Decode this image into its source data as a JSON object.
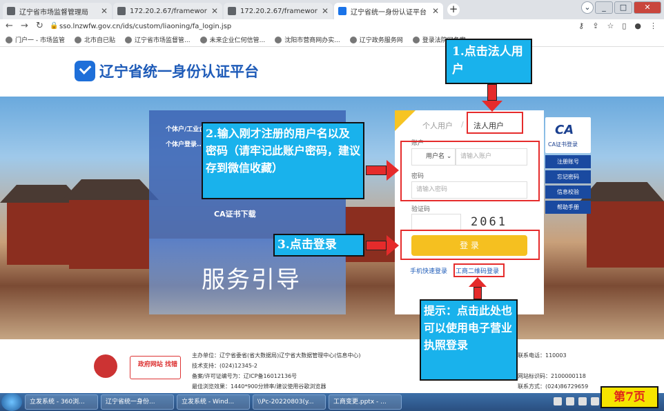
{
  "browser": {
    "tabs": [
      {
        "title": "辽宁省市场监督管理局",
        "active": false
      },
      {
        "title": "172.20.2.67/framework/console",
        "active": false
      },
      {
        "title": "172.20.2.67/framework/console",
        "active": false
      },
      {
        "title": "辽宁省统一身份认证平台",
        "active": true
      }
    ],
    "url": "sso.lnzwfw.gov.cn/ids/custom/liaoning/fa_login.jsp",
    "bookmarks": [
      "门户一 - 市场监管",
      "北市自已贴",
      "辽宁省市场监督管...",
      "未来企业仁何信管...",
      "沈阳市营商网办实...",
      "辽宁政务服务网",
      "登录法院网备案"
    ]
  },
  "page": {
    "site_title": "辽宁省统一身份认证平台",
    "info_lines": [
      "个体户/工业企",
      "个体户登录..."
    ],
    "ca_download": "CA证书下载",
    "service_guide": "服务引导",
    "login": {
      "tab_personal": "个人用户",
      "tab_sep": "/",
      "tab_legal": "法人用户",
      "account_label": "账户",
      "account_type": "用户名",
      "account_placeholder": "请输入账户",
      "password_label": "密码",
      "password_placeholder": "请输入密码",
      "captcha_label": "验证码",
      "captcha_value": "2061",
      "login_button": "登 录",
      "phone_login": "手机快速登录",
      "qr_login": "工商二维码登录"
    },
    "side": {
      "ca_logo": "CA",
      "ca_login": "CA证书登录",
      "links": [
        "注册账号",
        "忘记密码",
        "信息校验",
        "帮助手册"
      ]
    },
    "footer": {
      "gov_badge": "政府网站\n找错",
      "lines": [
        "主办单位：辽宁省委省(省大数据局)辽宁省大数据管理中心(信息中心)",
        "技术支持：(024)12345-2",
        "备案/许可证编号为：辽ICP备16012136号",
        "最佳浏览效果：1440*900分辨率/建议使用谷歌浏览器",
        "联系电话：110003",
        "网站标识码：2100000118",
        "联系方式：(024)86729659"
      ]
    }
  },
  "annotations": {
    "step1": "1.点击法人用户",
    "step2": "2.输入刚才注册的用户名以及密码（请牢记此账户密码，建议存到微信收藏）",
    "step3": "3.点击登录",
    "hint": "提示：点击此处也可以使用电子营业执照登录",
    "page_number": "第7页"
  },
  "taskbar": {
    "items": [
      "立发系统 - 360浏...",
      "辽宁省统一身份...",
      "立发系统 - Wind...",
      "\\\\Pc-20220803(y...",
      "工商变更.pptx - ..."
    ]
  }
}
